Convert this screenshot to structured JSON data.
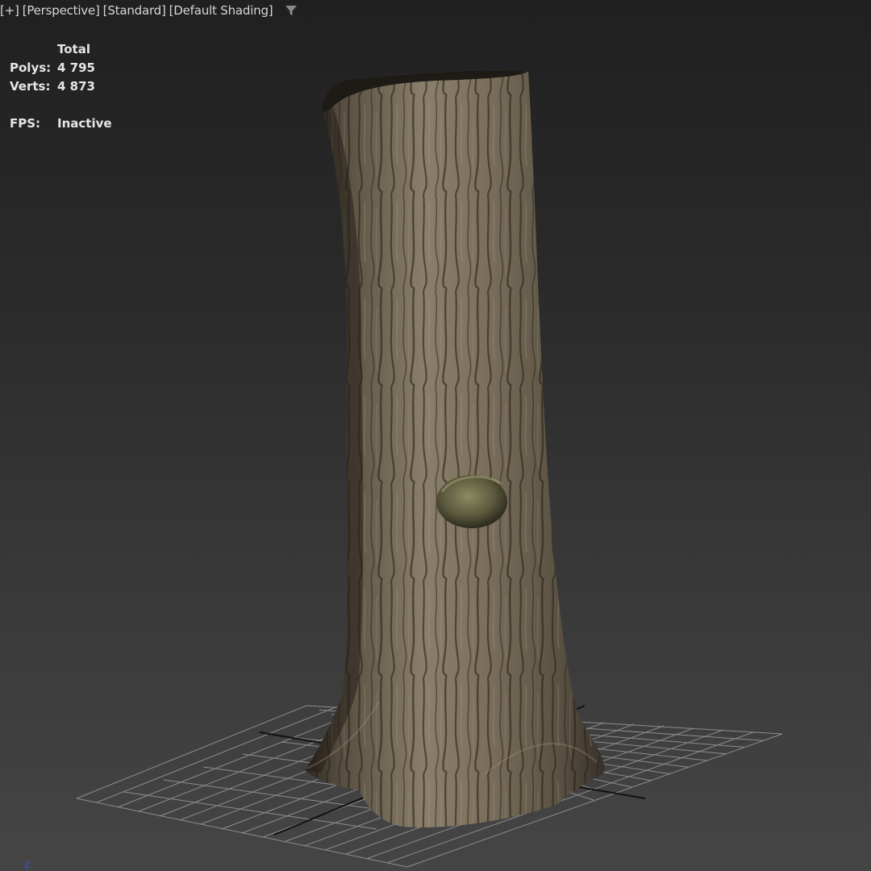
{
  "viewport": {
    "menu_plus": "[+]",
    "menu_view": "[Perspective]",
    "menu_style": "[Standard]",
    "menu_shading": "[Default Shading]",
    "filter_icon": "funnel-icon"
  },
  "stats": {
    "header": "Total",
    "polys_label": "Polys:",
    "polys_value": "4 795",
    "verts_label": "Verts:",
    "verts_value": "4 873",
    "fps_label": "FPS:",
    "fps_value": "Inactive"
  },
  "scene": {
    "object": "tree trunk",
    "grid_color": "#9a9a9a",
    "axis_color": "#111111",
    "bark_dark": "#3a342b",
    "bark_mid": "#6b6150",
    "bark_light": "#9b8f78"
  },
  "gizmo": {
    "axis_label": "z",
    "color": "#3a4fd0"
  }
}
